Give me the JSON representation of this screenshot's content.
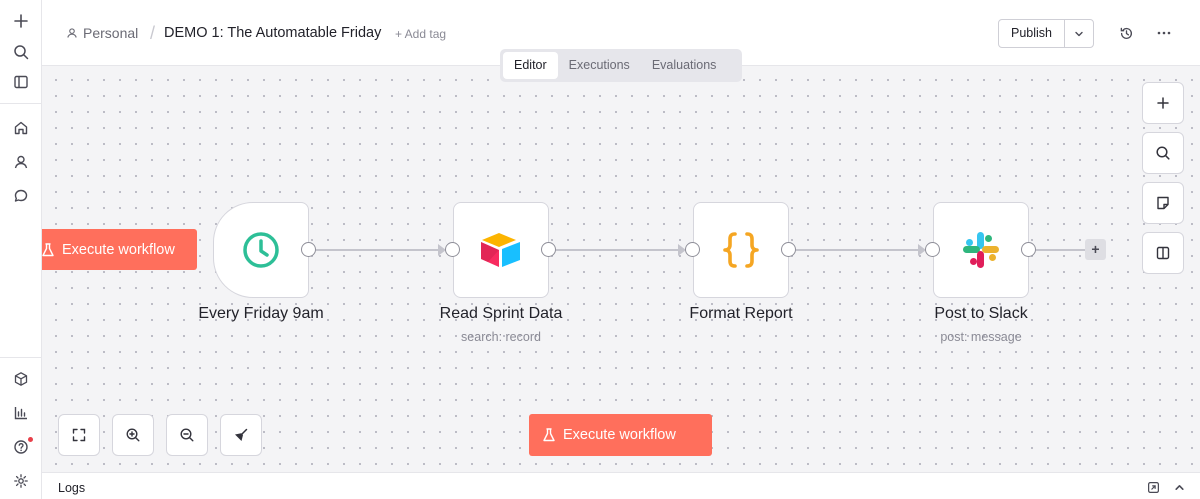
{
  "header": {
    "project": "Personal",
    "workflow_title": "DEMO 1: The Automatable Friday",
    "add_tag": "+ Add tag",
    "publish_label": "Publish"
  },
  "tabs": [
    {
      "label": "Editor",
      "active": true
    },
    {
      "label": "Executions",
      "active": false
    },
    {
      "label": "Evaluations",
      "active": false
    }
  ],
  "nodes": [
    {
      "title": "Every Friday 9am",
      "subtitle": "",
      "icon": "clock-icon"
    },
    {
      "title": "Read Sprint Data",
      "subtitle": "search: record",
      "icon": "airtable-icon"
    },
    {
      "title": "Format Report",
      "subtitle": "",
      "icon": "code-braces-icon"
    },
    {
      "title": "Post to Slack",
      "subtitle": "post: message",
      "icon": "slack-icon"
    }
  ],
  "execute": {
    "label_main": "Execute workflow",
    "label_trigger": "Execute workflow"
  },
  "logs": {
    "label": "Logs"
  },
  "colors": {
    "accent": "#ff6f5c",
    "canvas_bg": "#f4f4f6",
    "clock": "#2dbf97",
    "braces": "#f5a623"
  }
}
